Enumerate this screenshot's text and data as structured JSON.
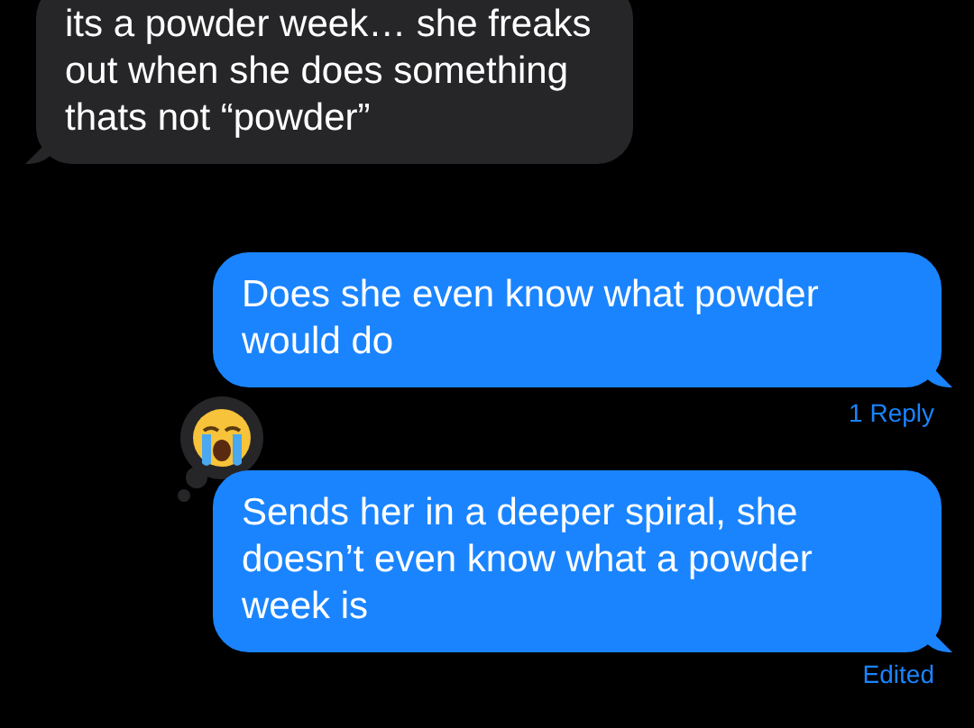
{
  "messages": [
    {
      "kind": "incoming",
      "text": "its a powder week… she freaks out when she does something thats not “powder”"
    },
    {
      "kind": "outgoing",
      "text": "Does she even know what powder would do",
      "footer": "1 Reply"
    },
    {
      "kind": "outgoing",
      "text": "Sends her in a deeper spiral, she doesn’t even know what a powder week is",
      "reacted": true,
      "footer": "Edited"
    }
  ]
}
